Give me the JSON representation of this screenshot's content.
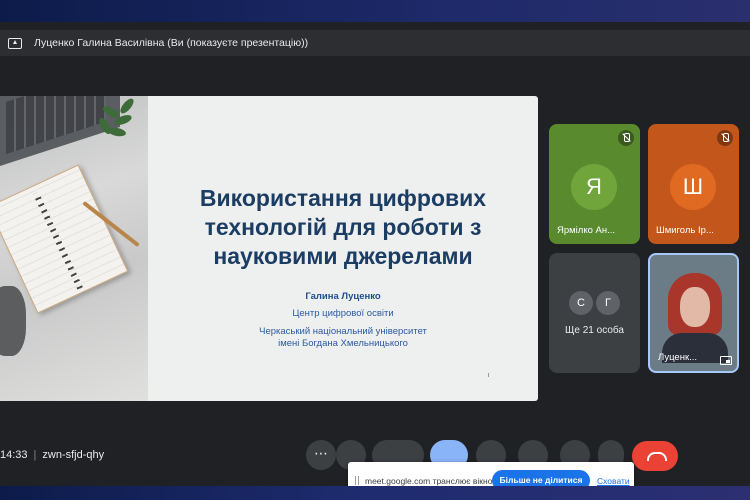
{
  "window": {
    "title": "Луценко Галина Василівна (Ви (показуєте презентацію))"
  },
  "slide": {
    "title_lines": [
      "Використання цифрових",
      "технологій для роботи з",
      "науковими джерелами"
    ],
    "author": "Галина Луценко",
    "organization": "Центр цифрової освіти",
    "university_lines": [
      "Черкаський національний університет",
      "імені Богдана Хмельницького"
    ]
  },
  "participants": [
    {
      "initial": "Я",
      "name": "Ярмілко Ан...",
      "color": "#6fa53a",
      "muted": true
    },
    {
      "initial": "Ш",
      "name": "Шмиголь Ір...",
      "color": "#e06a21",
      "muted": true
    }
  ],
  "others": {
    "initials": [
      "С",
      "Г"
    ],
    "label": "Ще 21 особа"
  },
  "self_tile": {
    "name": "Луценк..."
  },
  "meeting": {
    "time": "14:33",
    "separator": "|",
    "code": "zwn-sfjd-qhy",
    "more_label": "⋯"
  },
  "share_bar": {
    "message": "meet.google.com транслює вікно.",
    "stop_label": "Більше не ділитися",
    "hide_label": "Сховати"
  }
}
